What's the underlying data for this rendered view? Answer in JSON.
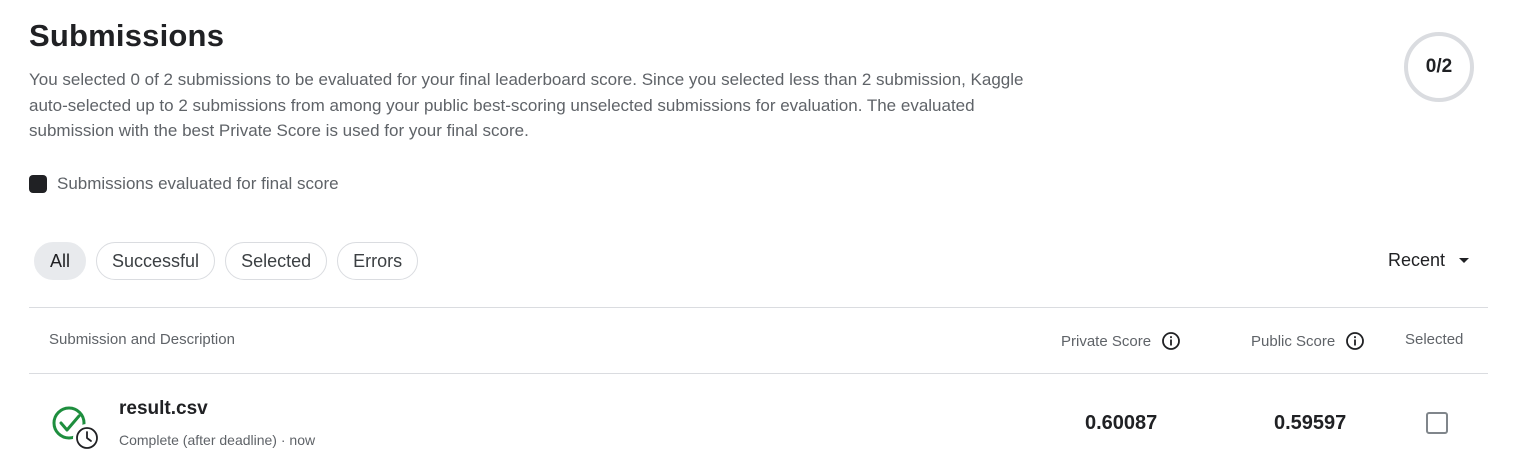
{
  "header": {
    "title": "Submissions",
    "description": "You selected 0 of 2 submissions to be evaluated for your final leaderboard score. Since you selected less than 2 submission, Kaggle auto-selected up to 2 submissions from among your public best-scoring unselected submissions for evaluation. The evaluated submission with the best Private Score is used for your final score.",
    "counter": "0/2"
  },
  "legend": {
    "label": "Submissions evaluated for final score",
    "swatch_color": "#202124"
  },
  "filters": [
    {
      "label": "All",
      "active": true
    },
    {
      "label": "Successful",
      "active": false
    },
    {
      "label": "Selected",
      "active": false
    },
    {
      "label": "Errors",
      "active": false
    }
  ],
  "sort": {
    "label": "Recent",
    "icon": "caret-down-icon"
  },
  "table": {
    "columns": {
      "submission": "Submission and Description",
      "private_score": "Private Score",
      "public_score": "Public Score",
      "selected": "Selected"
    },
    "rows": [
      {
        "file_name": "result.csv",
        "status": "Complete (after deadline) · now",
        "status_icon": "check-clock-icon",
        "private_score": "0.60087",
        "public_score": "0.59597",
        "selected": false
      }
    ]
  },
  "colors": {
    "success_green": "#1e8e3e",
    "text_primary": "#202124",
    "text_secondary": "#5f6368",
    "border": "#dadce0"
  }
}
